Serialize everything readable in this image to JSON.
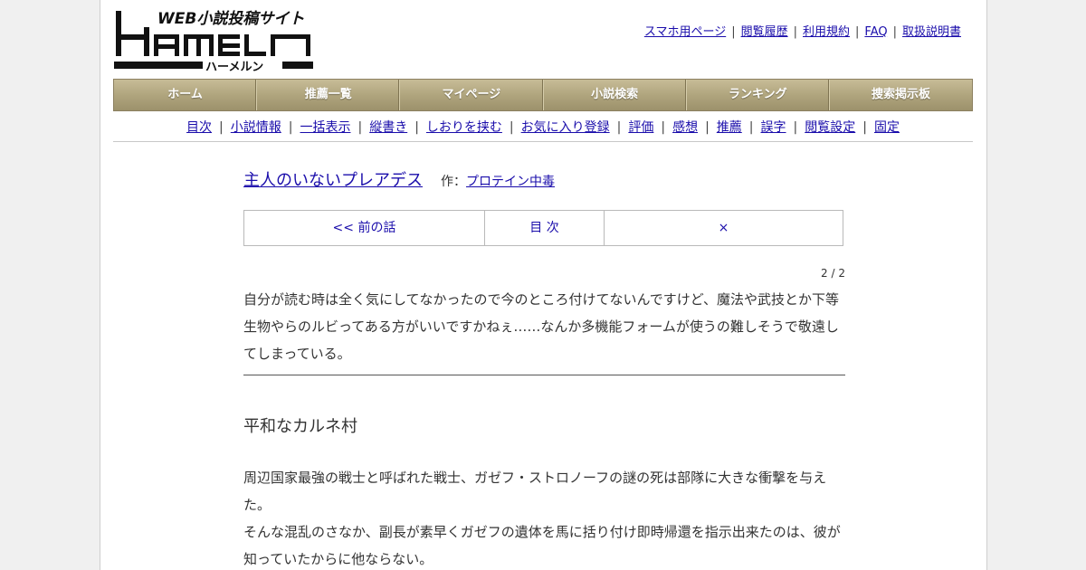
{
  "logo": {
    "tagline": "WEB小説投稿サイト",
    "name": "HAMELN",
    "kana": "ハーメルン"
  },
  "top_links": [
    "スマホ用ページ",
    "閲覧履歴",
    "利用規約",
    "FAQ",
    "取扱説明書"
  ],
  "main_nav": [
    "ホーム",
    "推薦一覧",
    "マイページ",
    "小説検索",
    "ランキング",
    "捜索掲示板"
  ],
  "sub_nav": [
    "目次",
    "小説情報",
    "一括表示",
    "縦書き",
    "しおりを挟む",
    "お気に入り登録",
    "評価",
    "感想",
    "推薦",
    "誤字",
    "閲覧設定",
    "固定"
  ],
  "novel": {
    "title": "主人のいないプレアデス",
    "author_label": "作：",
    "author": "プロテイン中毒"
  },
  "pager": {
    "prev": "<< 前の話",
    "toc": "目 次",
    "close": "×"
  },
  "page_counter": "2 / 2",
  "preface": "自分が読む時は全く気にしてなかったので今のところ付けてないんですけど、魔法や武技とか下等生物やらのルビってある方がいいですかねぇ……なんか多機能フォームが使うの難しそうで敬遠してしまっている。",
  "chapter_title": "平和なカルネ村",
  "paragraphs": [
    "周辺国家最強の戦士と呼ばれた戦士、ガゼフ・ストロノーフの謎の死は部隊に大きな衝撃を与えた。",
    "そんな混乱のさなか、副長が素早くガゼフの遺体を馬に括り付け即時帰還を指示出来たのは、彼が知っていたからに他ならない。"
  ],
  "colors": {
    "link": "#1a0dab",
    "nav_bar": "#b0a57e",
    "page_bg": "#f0f0f0"
  }
}
